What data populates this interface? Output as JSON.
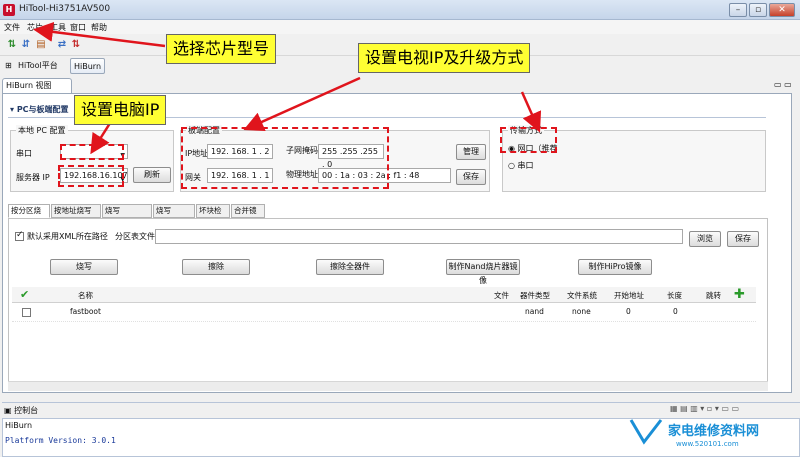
{
  "window": {
    "title": "HiTool-Hi3751AV500",
    "logo": "H",
    "controls": [
      "–",
      "▫",
      "✕"
    ]
  },
  "menu": [
    "文件",
    "芯片",
    "工具",
    "窗口",
    "帮助"
  ],
  "toolbar2": {
    "hitool_platform": "HiTool平台",
    "hiburn": "HiBurn"
  },
  "view_tab": "HiBurn 视图",
  "section_title": "PC与板端配置",
  "local_pc": {
    "group_label": "本地 PC 配置",
    "port_label": "串口",
    "port_value": "",
    "server_ip_label": "服务器 IP",
    "server_ip_value": "192.168.16.107",
    "refresh_label": "刷新"
  },
  "board": {
    "group_label": "板端配置",
    "ip_label": "IP地址",
    "ip_value": "192. 168. 1 . 2",
    "mask_label": "子网掩码",
    "mask_value": "255 .255 .255 . 0",
    "gateway_label": "网关",
    "gateway_value": "192. 168. 1 . 1",
    "mac_label": "物理地址",
    "mac_value": "00 : 1a : 03 : 2a : f1 : 48",
    "manage_label": "管理",
    "save_label": "保存"
  },
  "transfer": {
    "group_label": "传输方式",
    "network_label": "网口（推荐",
    "serial_label": "串口"
  },
  "subtabs": [
    "按分区烧写",
    "按地址烧写",
    "烧写Fastboot",
    "烧写eMMC",
    "坏块检测",
    "合并镜像"
  ],
  "partition": {
    "xml_checkbox_label": "默认采用XML所在路径",
    "file_label": "分区表文件",
    "file_value": "",
    "browse_label": "浏览",
    "save_label": "保存"
  },
  "actions": [
    "烧写",
    "擦除",
    "擦除全器件",
    "制作Nand烧片器镜像",
    "制作HiPro镜像"
  ],
  "grid": {
    "headers": [
      "名称",
      "文件",
      "器件类型",
      "文件系统",
      "开始地址",
      "长度",
      "跳转"
    ],
    "rows": [
      {
        "name": "fastboot",
        "file": "",
        "device": "nand",
        "fs": "none",
        "start": "0",
        "length": "0",
        "jump": ""
      }
    ]
  },
  "console": {
    "tab_label": "控制台",
    "source": "HiBurn",
    "output": "Platform Version: 3.0.1"
  },
  "annotations": {
    "chip": "选择芯片型号",
    "tv_ip": "设置电视IP及升级方式",
    "pc_ip": "设置电脑IP"
  },
  "watermark": {
    "text": "家电维修资料网",
    "url": "www.520101.com"
  },
  "colors": {
    "annotation_red": "#e0141c",
    "callout_yellow": "#ffff33",
    "watermark_blue": "#1a8fd6"
  }
}
